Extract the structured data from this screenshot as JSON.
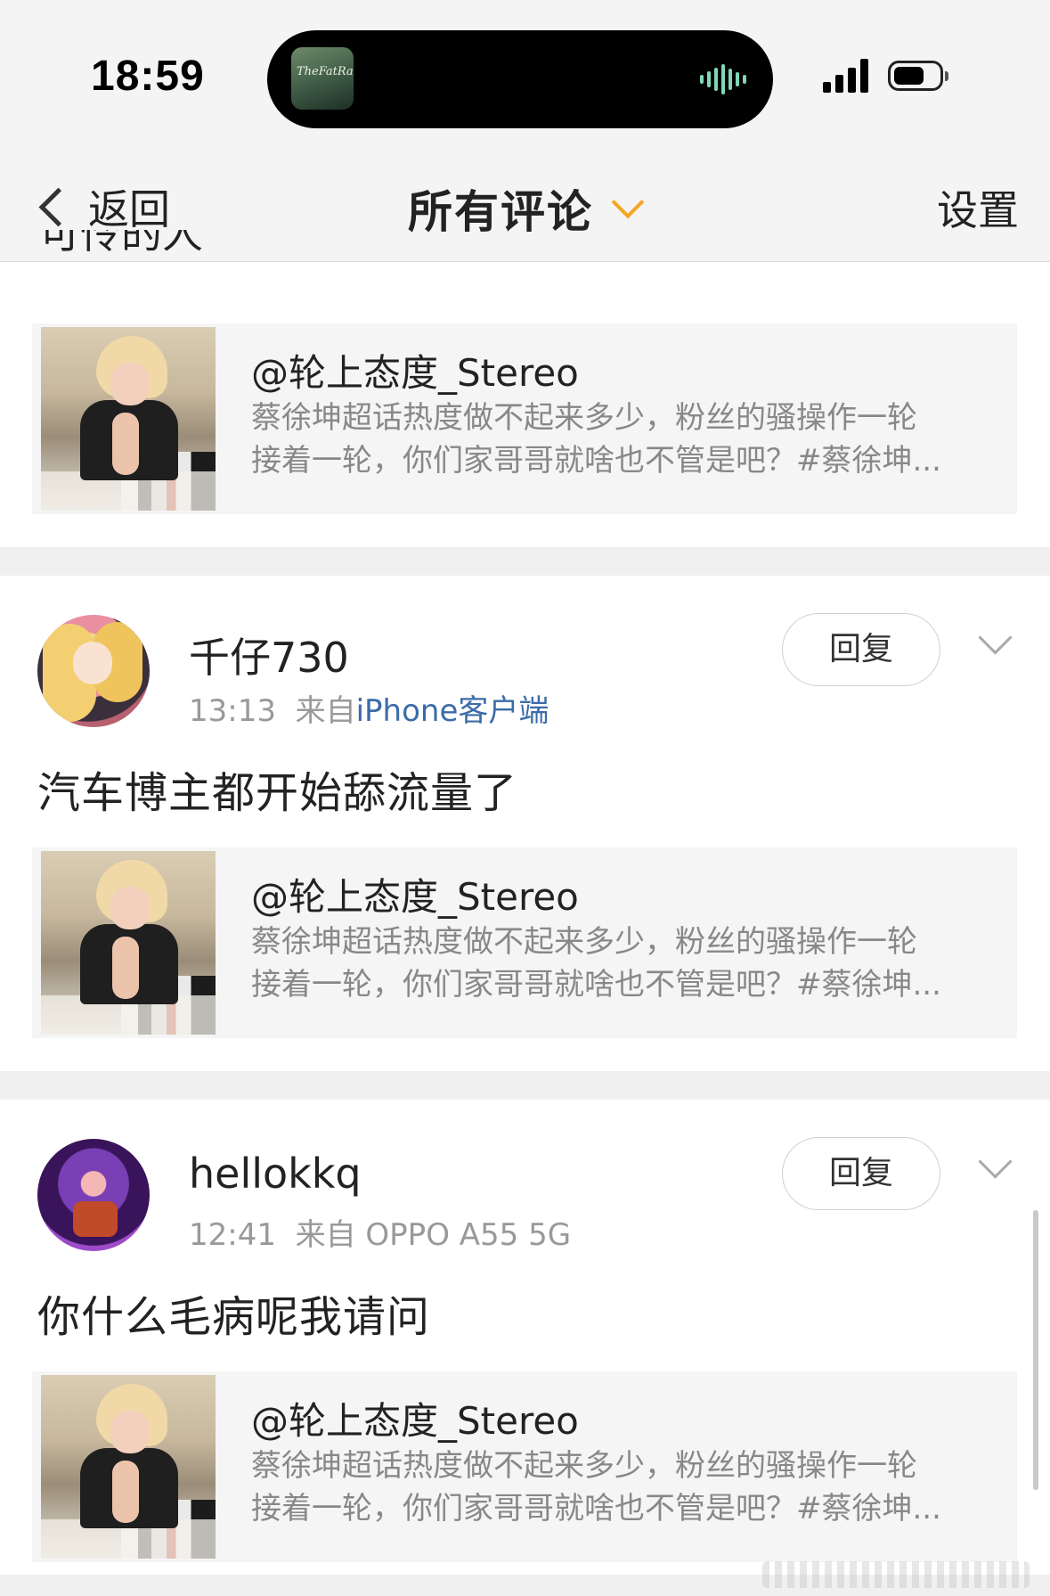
{
  "status_bar": {
    "time": "18:59",
    "now_playing_art_text": "TheFatRat"
  },
  "nav": {
    "back_label": "返回",
    "title": "所有评论",
    "settings_label": "设置"
  },
  "cut_text": "可怜的人",
  "quoted_post": {
    "author": "@轮上态度_Stereo",
    "line1": "蔡徐坤超话热度做不起来多少，粉丝的骚操作一轮",
    "line2": "接着一轮，你们家哥哥就啥也不管是吧？#蔡徐坤..."
  },
  "comments": [
    {
      "username": "千仔730",
      "time": "13:13",
      "source_prefix": "来自",
      "source": "iPhone客户端",
      "reply_label": "回复",
      "text": "汽车博主都开始舔流量了"
    },
    {
      "username": "hellokkq",
      "time": "12:41",
      "source_prefix": "来自",
      "source": "OPPO A55 5G",
      "reply_label": "回复",
      "text": "你什么毛病呢我请问"
    }
  ]
}
